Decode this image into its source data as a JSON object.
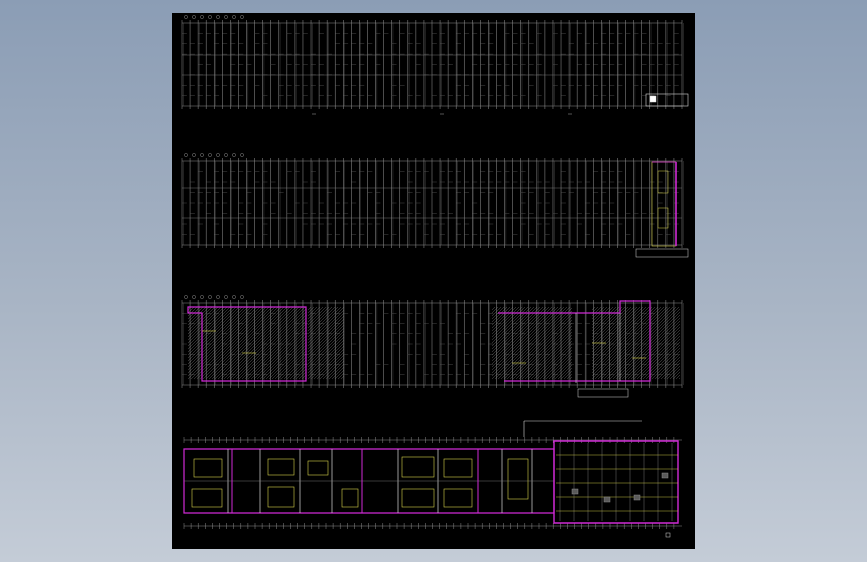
{
  "viewer": {
    "background": "#9aa8bb",
    "sheet_color": "#000000"
  },
  "drawing": {
    "colors": {
      "grid": "#8c8c8c",
      "grid_light": "#5a5a5a",
      "magenta": "#d02ad6",
      "yellow": "#d8d34a",
      "white": "#d9d9d9"
    },
    "panels": [
      {
        "id": "plan-1",
        "kind": "column-grid",
        "has_magenta_zones": false,
        "has_title_block": true
      },
      {
        "id": "plan-2",
        "kind": "column-grid",
        "has_magenta_zones": true,
        "has_title_block": true
      },
      {
        "id": "plan-3",
        "kind": "hatched-layout",
        "has_magenta_zones": true,
        "has_title_block": true
      },
      {
        "id": "plan-4",
        "kind": "room-layout",
        "has_magenta_zones": true,
        "has_title_block": true
      }
    ]
  }
}
